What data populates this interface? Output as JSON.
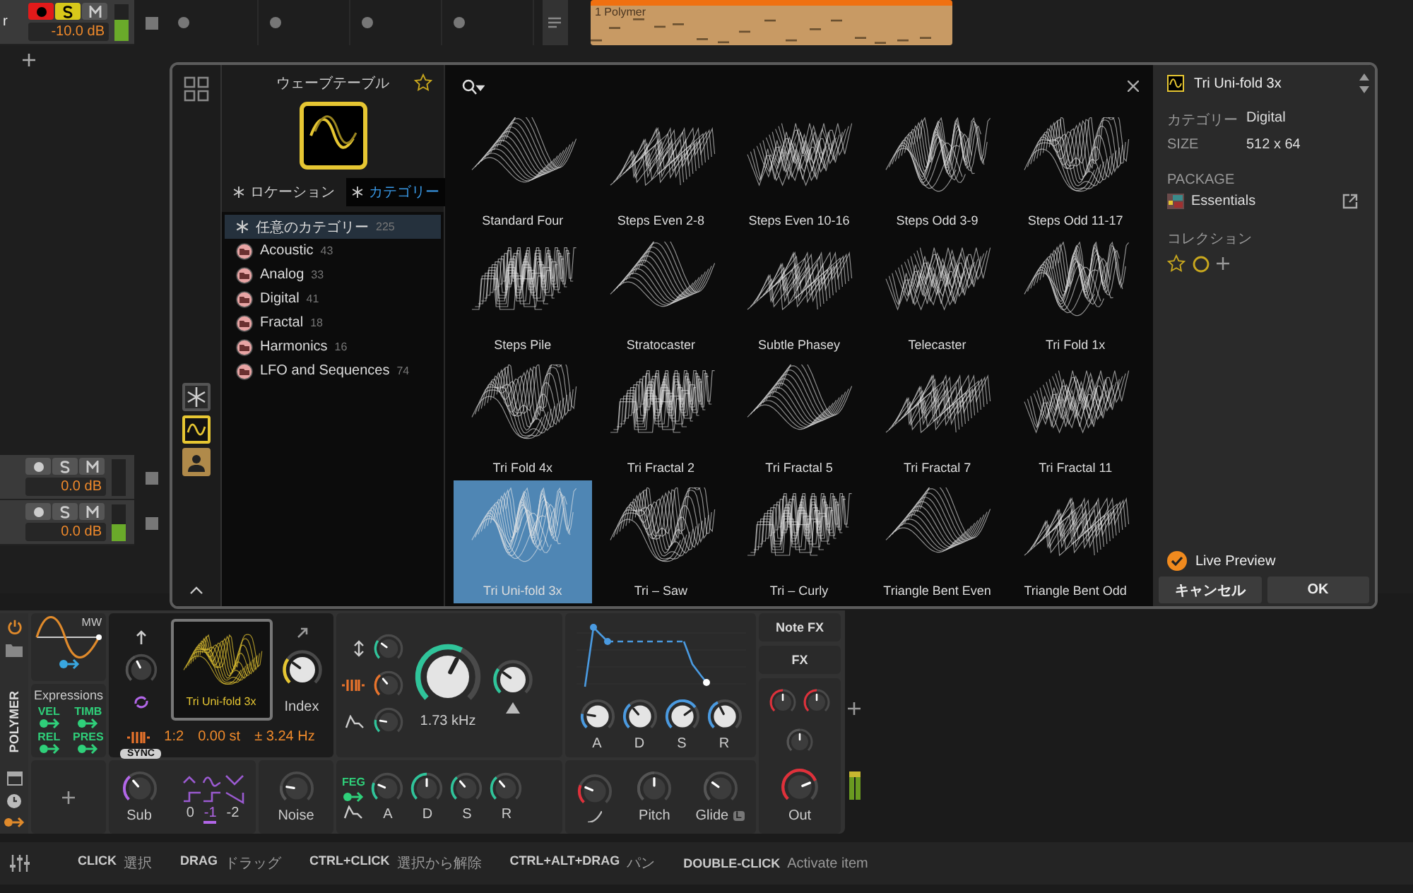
{
  "arranger": {
    "tracks": [
      {
        "name": "r",
        "volume": "-10.0 dB",
        "armed": true,
        "solo": true,
        "mute": false,
        "level": 0.55
      },
      {
        "volume": "0.0 dB",
        "armed": false,
        "solo": false,
        "mute": false
      },
      {
        "volume": "0.0 dB",
        "armed": false,
        "solo": false,
        "mute": false,
        "level": 0.45
      }
    ],
    "clip": {
      "name": "1 Polymer"
    }
  },
  "browser": {
    "title": "ウェーブテーブル",
    "favorite": false,
    "rail": [
      {
        "kind": "all",
        "selected": false
      },
      {
        "kind": "wavetable",
        "selected": true
      },
      {
        "kind": "user",
        "selected": false
      }
    ],
    "filter_tabs": [
      {
        "label": "ロケーション",
        "selected": false
      },
      {
        "label": "カテゴリー",
        "selected": true
      }
    ],
    "categories": [
      {
        "kind": "any",
        "label": "任意のカテゴリー",
        "count": "225",
        "selected": true
      },
      {
        "kind": "folder",
        "label": "Acoustic",
        "count": "43",
        "selected": false
      },
      {
        "kind": "folder",
        "label": "Analog",
        "count": "33",
        "selected": false
      },
      {
        "kind": "folder",
        "label": "Digital",
        "count": "41",
        "selected": false
      },
      {
        "kind": "folder",
        "label": "Fractal",
        "count": "18",
        "selected": false
      },
      {
        "kind": "folder",
        "label": "Harmonics",
        "count": "16",
        "selected": false
      },
      {
        "kind": "folder",
        "label": "LFO and Sequences",
        "count": "74",
        "selected": false
      }
    ],
    "items": [
      {
        "name": "Standard Four",
        "selected": false
      },
      {
        "name": "Steps Even 2-8",
        "selected": false
      },
      {
        "name": "Steps Even 10-16",
        "selected": false
      },
      {
        "name": "Steps Odd 3-9",
        "selected": false
      },
      {
        "name": "Steps Odd 11-17",
        "selected": false
      },
      {
        "name": "Steps Pile",
        "selected": false
      },
      {
        "name": "Stratocaster",
        "selected": false
      },
      {
        "name": "Subtle Phasey",
        "selected": false
      },
      {
        "name": "Telecaster",
        "selected": false
      },
      {
        "name": "Tri Fold 1x",
        "selected": false
      },
      {
        "name": "Tri Fold 4x",
        "selected": false
      },
      {
        "name": "Tri Fractal 2",
        "selected": false
      },
      {
        "name": "Tri Fractal 5",
        "selected": false
      },
      {
        "name": "Tri Fractal 7",
        "selected": false
      },
      {
        "name": "Tri Fractal 11",
        "selected": false
      },
      {
        "name": "Tri Uni-fold 3x",
        "selected": true
      },
      {
        "name": "Tri – Saw",
        "selected": false
      },
      {
        "name": "Tri – Curly",
        "selected": false
      },
      {
        "name": "Triangle Bent Even",
        "selected": false
      },
      {
        "name": "Triangle Bent Odd",
        "selected": false
      }
    ],
    "details": {
      "name": "Tri Uni-fold 3x",
      "fields": [
        {
          "label": "カテゴリー",
          "value": "Digital"
        },
        {
          "label": "SIZE",
          "value": "512 x 64"
        }
      ],
      "package_heading": "PACKAGE",
      "package": "Essentials",
      "collection_heading": "コレクション",
      "live_preview": {
        "label": "Live Preview",
        "checked": true
      },
      "buttons": [
        "キャンセル",
        "OK"
      ]
    }
  },
  "device": {
    "name": "POLYMER",
    "lfo": {
      "label": "MW"
    },
    "expressions": {
      "title": "Expressions",
      "items": [
        "VEL",
        "TIMB",
        "REL",
        "PRES"
      ]
    },
    "oscillator": {
      "wavetable": "Tri Uni-fold 3x",
      "index_label": "Index",
      "ratio": "1:2",
      "pitch": "0.00 st",
      "detune": "± 3.24 Hz",
      "sync": "SYNC"
    },
    "sub": {
      "label": "Sub",
      "octaves": [
        {
          "label": "0",
          "selected": false
        },
        {
          "label": "-1",
          "selected": true
        },
        {
          "label": "-2",
          "selected": false
        }
      ]
    },
    "noise": {
      "label": "Noise"
    },
    "filter": {
      "cutoff": "1.73 kHz"
    },
    "feg": {
      "label": "FEG",
      "knobs": [
        "A",
        "D",
        "S",
        "R"
      ]
    },
    "aeg": {
      "knobs": [
        "A",
        "D",
        "S",
        "R"
      ]
    },
    "voice": {
      "knobs": [
        "Pitch",
        "Glide"
      ],
      "glide_badge": "L"
    },
    "output": {
      "note_fx": "Note FX",
      "fx": "FX",
      "out": "Out"
    }
  },
  "status_bar": {
    "hints": [
      {
        "key": "CLICK",
        "action": "選択"
      },
      {
        "key": "DRAG",
        "action": "ドラッグ"
      },
      {
        "key": "CTRL+CLICK",
        "action": "選択から解除"
      },
      {
        "key": "CTRL+ALT+DRAG",
        "action": "パン"
      },
      {
        "key": "DOUBLE-CLICK",
        "action": "Activate item"
      }
    ]
  }
}
